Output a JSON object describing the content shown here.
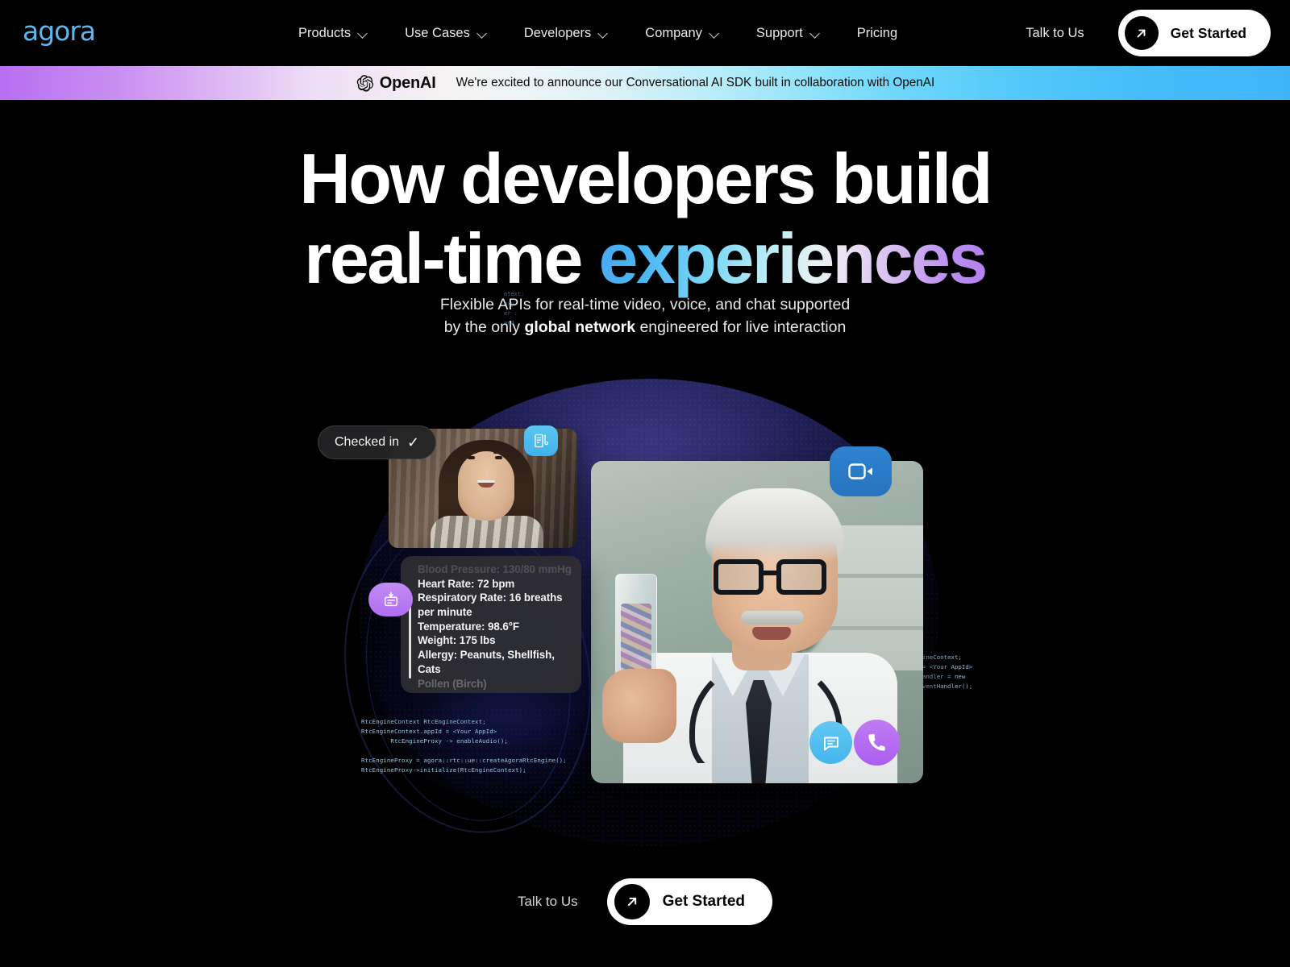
{
  "nav": {
    "logo_text": "agora",
    "items": [
      {
        "label": "Products",
        "has_dropdown": true
      },
      {
        "label": "Use Cases",
        "has_dropdown": true
      },
      {
        "label": "Developers",
        "has_dropdown": true
      },
      {
        "label": "Company",
        "has_dropdown": true
      },
      {
        "label": "Support",
        "has_dropdown": true
      },
      {
        "label": "Pricing",
        "has_dropdown": false
      }
    ],
    "talk_to_us": "Talk to Us",
    "get_started": "Get Started"
  },
  "banner": {
    "brand": "OpenAI",
    "message": "We're excited to announce our Conversational AI SDK built in collaboration with OpenAI",
    "gradient_from": "#b86ef0",
    "gradient_mid": "#f6f3f3",
    "gradient_to": "#3fb5f8"
  },
  "hero": {
    "headline_line1": "How developers build",
    "headline_line2_plain": "real-time ",
    "headline_line2_gradient": "experiences",
    "sub_part1": "Flexible APIs for real-time video, voice, and chat supported",
    "sub_part2_pre": "by the only ",
    "sub_part2_bold": "global network",
    "sub_part2_post": " engineered for live interaction",
    "gradient_start": "#4aa8f0",
    "gradient_end": "#b47ff0"
  },
  "visual": {
    "checked_in_label": "Checked in",
    "checked_in_glyph": "✓",
    "vitals": {
      "faded_top": "Blood Pressure: 130/80 mmHg",
      "lines": [
        "Heart Rate: 72 bpm",
        "Respiratory Rate: 16 breaths",
        "per minute",
        "Temperature: 98.6°F",
        "Weight: 175 lbs",
        "Allergy: Peanuts, Shellfish,",
        "Cats"
      ],
      "faded_bottom": "Pollen (Birch)"
    },
    "code_left": "RtcEngineContext RtcEngineContext;\nRtcEngineContext.appId = <Your AppId>\n        RtcEngineProxy -> enableAudio();\n\nRtcEngineProxy = agora::rtc::ue::createAgoraRtcEngine();\nRtcEngineProxy->initialize(RtcEngineContext);",
    "code_right": "ngineContext;\nd = <Your AppId>\ntHandler = new\nsEventHandler();",
    "code_top": "ntext:\noxy\ner :\nand_",
    "icons": {
      "prescription": "prescription-icon",
      "card": "card-icon",
      "video": "video-camera-icon",
      "chat": "chat-bubble-icon",
      "phone": "phone-icon"
    },
    "colors": {
      "prescription_badge": "#3fb2ec",
      "card_badge": "#b06ef0",
      "video_badge": "#2673bf",
      "chat_badge": "#44b5ec",
      "phone_badge": "#ab5df0"
    }
  },
  "footer_cta": {
    "talk_to_us": "Talk to Us",
    "get_started": "Get Started"
  }
}
